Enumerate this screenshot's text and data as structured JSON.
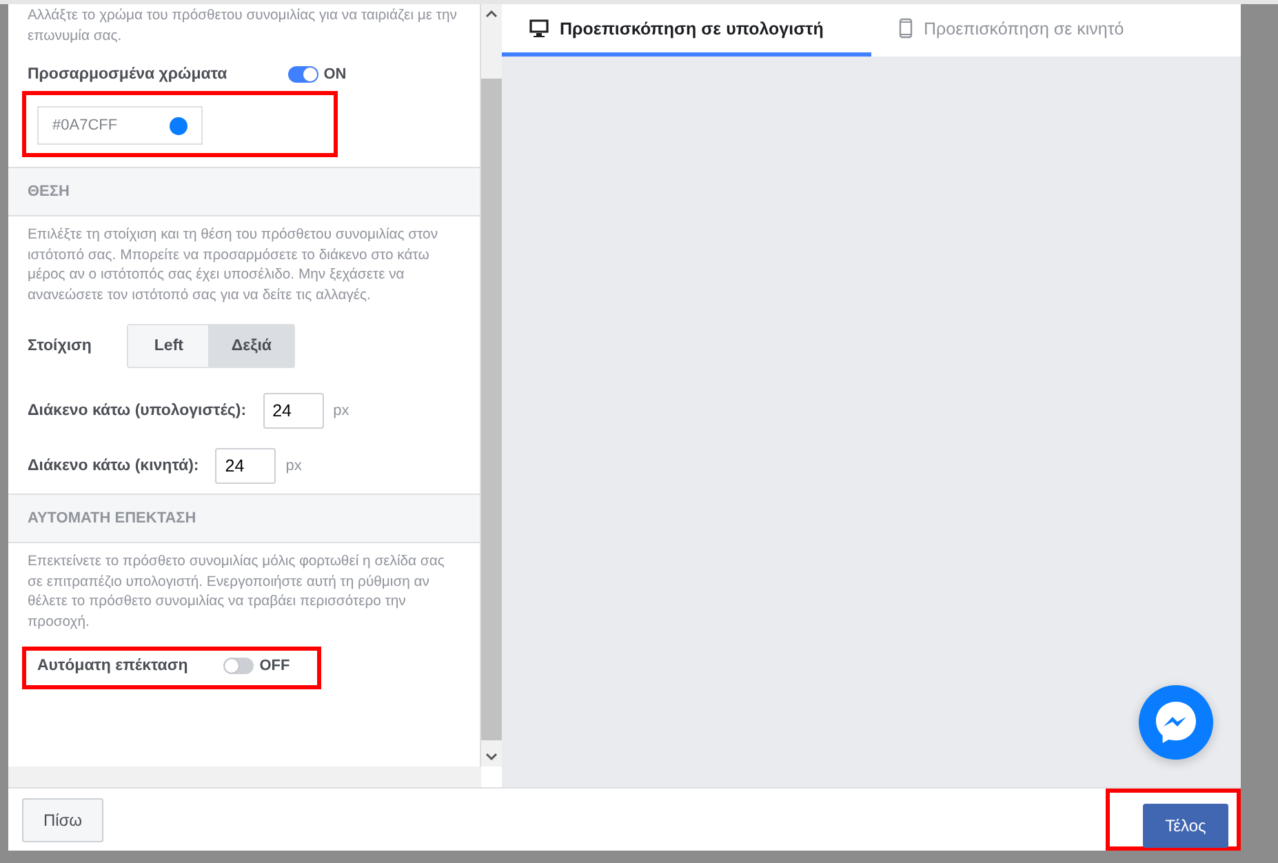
{
  "color_section": {
    "description": "Αλλάξτε το χρώμα του πρόσθετου συνομιλίας για να ταιριάζει με την επωνυμία σας.",
    "custom_colors": {
      "label": "Προσαρμοσμένα χρώματα",
      "on": true,
      "state_text": "ON"
    },
    "color_field": {
      "value": "#0A7CFF",
      "color": "#0a7cff",
      "highlighted": true
    }
  },
  "position_section": {
    "heading": "ΘΕΣΗ",
    "description": "Επιλέξτε τη στοίχιση και τη θέση του πρόσθετου συνομιλίας στον ιστότοπό σας. Μπορείτε να προσαρμόσετε το διάκενο στο κάτω μέρος αν ο ιστότοπός σας έχει υποσέλιδο. Μην ξεχάσετε να ανανεώσετε τον ιστότοπό σας για να δείτε τις αλλαγές.",
    "alignment": {
      "label": "Στοίχιση",
      "options": [
        {
          "label": "Left",
          "selected": false
        },
        {
          "label": "Δεξιά",
          "selected": true
        }
      ]
    },
    "offsets": [
      {
        "label": "Διάκενο κάτω (υπολογιστές):",
        "value": "24",
        "unit": "px"
      },
      {
        "label": "Διάκενο κάτω (κινητά):",
        "value": "24",
        "unit": "px"
      }
    ]
  },
  "auto_expand_section": {
    "heading": "ΑΥΤΟΜΑΤΗ ΕΠΕΚΤΑΣΗ",
    "description": "Επεκτείνετε το πρόσθετο συνομιλίας μόλις φορτωθεί η σελίδα σας σε επιτραπέζιο υπολογιστή. Ενεργοποιήστε αυτή τη ρύθμιση αν θέλετε το πρόσθετο συνομιλίας να τραβάει περισσότερο την προσοχή.",
    "toggle": {
      "label": "Αυτόματη επέκταση",
      "on": false,
      "state_text": "OFF",
      "highlighted": true
    }
  },
  "preview_tabs": [
    {
      "label": "Προεπισκόπηση σε υπολογιστή",
      "selected": true
    },
    {
      "label": "Προεπισκόπηση σε κινητό",
      "selected": false
    }
  ],
  "footer": {
    "back_button": {
      "label": "Πίσω"
    },
    "done_button": {
      "label": "Τέλος",
      "highlighted": true
    }
  }
}
